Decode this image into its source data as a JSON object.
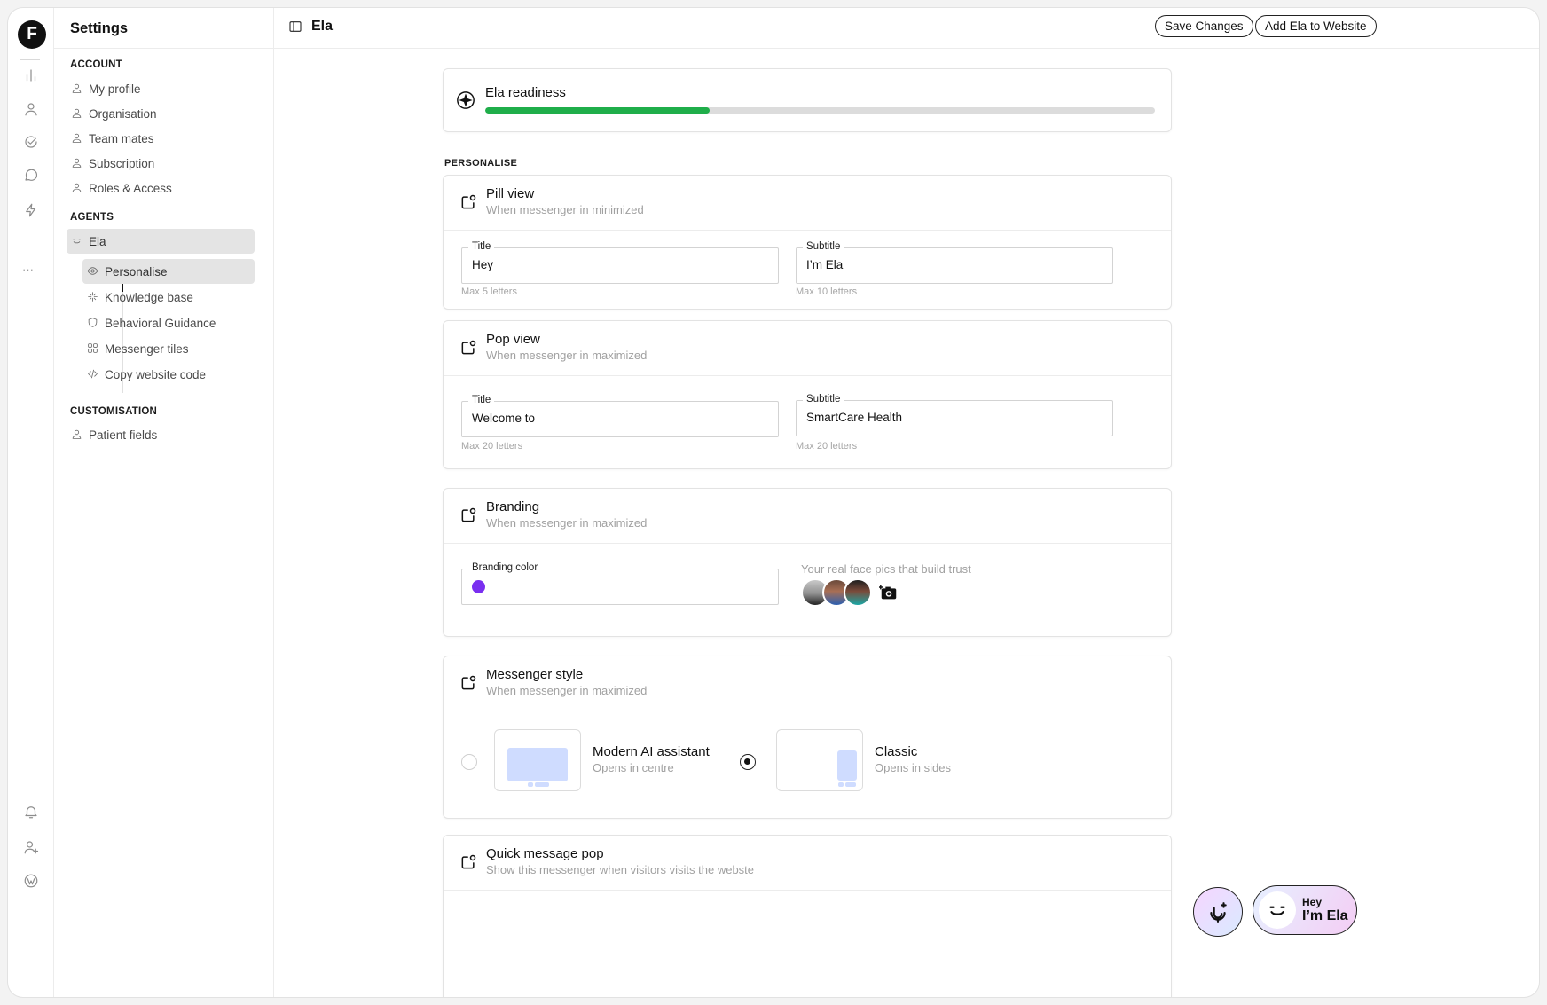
{
  "rail": {
    "logo": "F",
    "icons": [
      "bar-chart-icon",
      "user-icon",
      "check-badge-icon",
      "chat-icon",
      "bolt-icon",
      "more-icon",
      "bell-icon",
      "add-user-icon",
      "wordpress-icon"
    ],
    "more": "···"
  },
  "sidebar": {
    "title": "Settings",
    "account_label": "ACCOUNT",
    "account_items": [
      "My profile",
      "Organisation",
      "Team mates",
      "Subscription",
      "Roles & Access"
    ],
    "agents_label": "AGENTS",
    "agent": "Ela",
    "agent_items": [
      "Personalise",
      "Knowledge base",
      "Behavioral Guidance",
      "Messenger tiles",
      "Copy website code"
    ],
    "customisation_label": "CUSTOMISATION",
    "customisation_items": [
      "Patient fields"
    ]
  },
  "topbar": {
    "title": "Ela",
    "save_label": "Save Changes",
    "add_label": "Add Ela to Website"
  },
  "readiness": {
    "title": "Ela readiness",
    "progress": 0.335,
    "color": "#1fae4a"
  },
  "section_label": "PERSONALISE",
  "pill_view": {
    "title": "Pill view",
    "subtitle": "When messenger in minimized",
    "title_label": "Title",
    "title_value": "Hey",
    "title_hint": "Max 5 letters",
    "subtitle_label": "Subtitle",
    "subtitle_value": "I’m Ela",
    "subtitle_hint": "Max 10 letters"
  },
  "pop_view": {
    "title": "Pop view",
    "subtitle": "When messenger in maximized",
    "title_label": "Title",
    "title_value": "Welcome to",
    "title_hint": "Max 20 letters",
    "subtitle_label": "Subtitle",
    "subtitle_value": "SmartCare Health",
    "subtitle_hint": "Max 20 letters"
  },
  "branding": {
    "title": "Branding",
    "subtitle": "When messenger in maximized",
    "color_label": "Branding color",
    "color": "#7a2ff0",
    "faces_label": "Your real face pics that build trust"
  },
  "messenger_style": {
    "title": "Messenger style",
    "subtitle": "When messenger in maximized",
    "options": [
      {
        "name": "Modern AI assistant",
        "sub": "Opens in centre",
        "selected": false
      },
      {
        "name": "Classic",
        "sub": "Opens in sides",
        "selected": true
      }
    ]
  },
  "quick_pop": {
    "title": "Quick message pop",
    "subtitle": "Show this messenger when visitors visits the webste"
  },
  "widget": {
    "title": "Hey",
    "subtitle": "I’m Ela"
  }
}
